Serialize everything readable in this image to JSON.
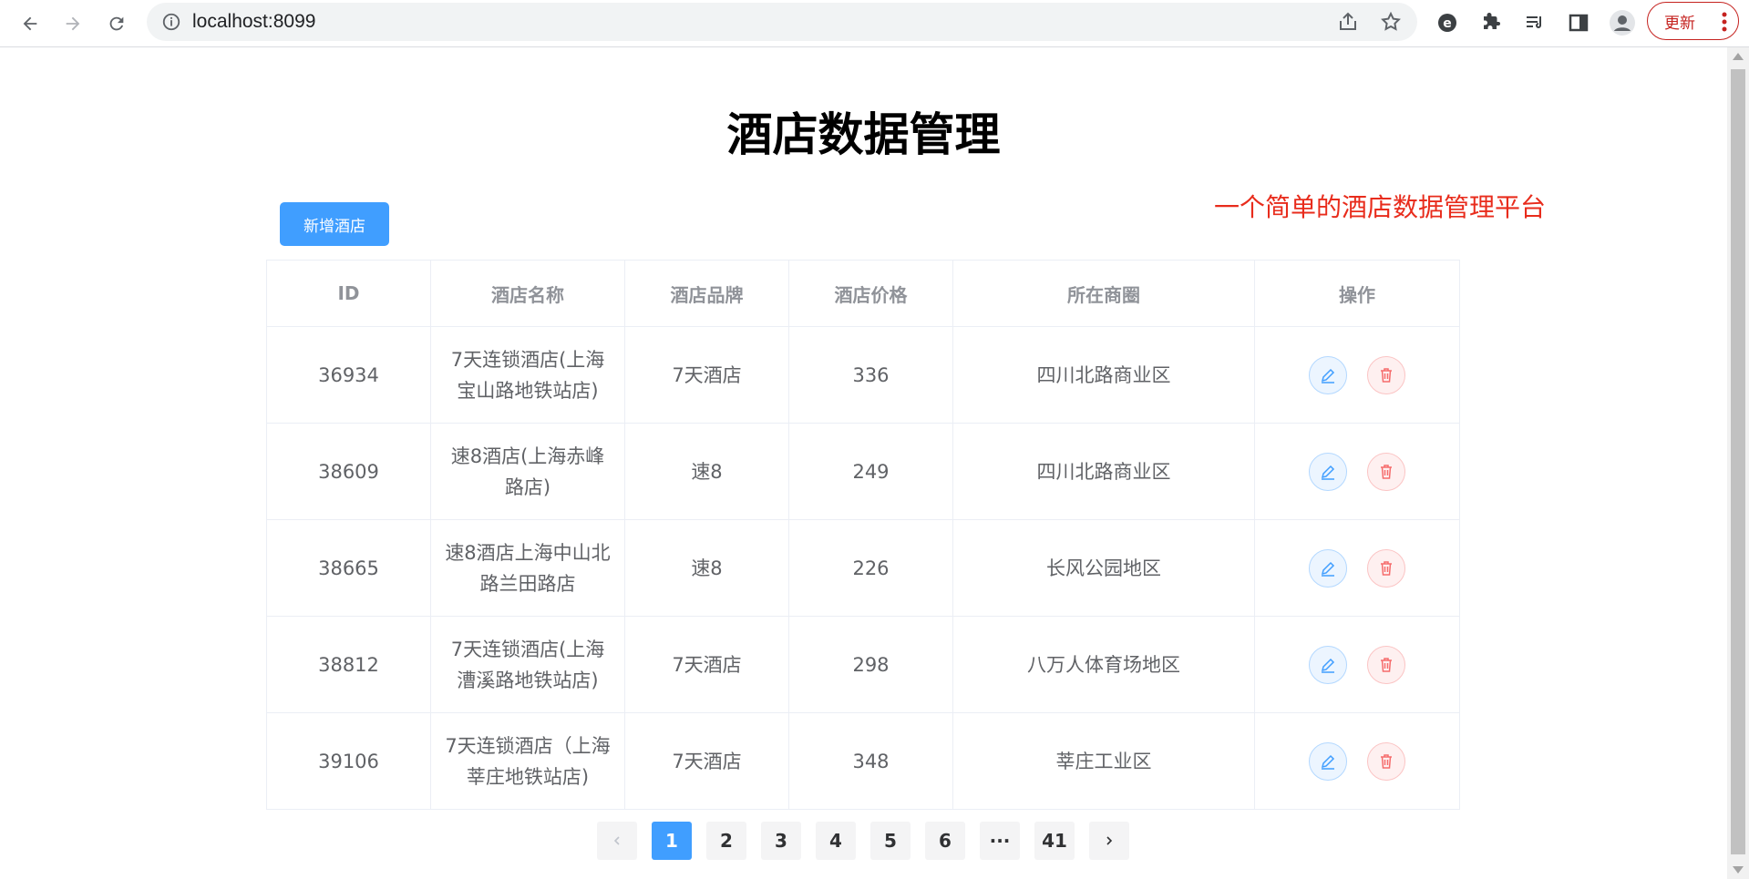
{
  "browser": {
    "url": "localhost:8099",
    "update_label": "更新"
  },
  "page": {
    "title": "酒店数据管理",
    "subtitle": "一个简单的酒店数据管理平台",
    "add_button": "新增酒店"
  },
  "table": {
    "headers": [
      "ID",
      "酒店名称",
      "酒店品牌",
      "酒店价格",
      "所在商圈",
      "操作"
    ],
    "rows": [
      {
        "id": "36934",
        "name": "7天连锁酒店(上海宝山路地铁站店)",
        "brand": "7天酒店",
        "price": "336",
        "area": "四川北路商业区"
      },
      {
        "id": "38609",
        "name": "速8酒店(上海赤峰路店)",
        "brand": "速8",
        "price": "249",
        "area": "四川北路商业区"
      },
      {
        "id": "38665",
        "name": "速8酒店上海中山北路兰田路店",
        "brand": "速8",
        "price": "226",
        "area": "长风公园地区"
      },
      {
        "id": "38812",
        "name": "7天连锁酒店(上海漕溪路地铁站店)",
        "brand": "7天酒店",
        "price": "298",
        "area": "八万人体育场地区"
      },
      {
        "id": "39106",
        "name": "7天连锁酒店（上海莘庄地铁站店)",
        "brand": "7天酒店",
        "price": "348",
        "area": "莘庄工业区"
      }
    ]
  },
  "pagination": {
    "pages": [
      "1",
      "2",
      "3",
      "4",
      "5",
      "6",
      "···",
      "41"
    ],
    "current": "1"
  }
}
